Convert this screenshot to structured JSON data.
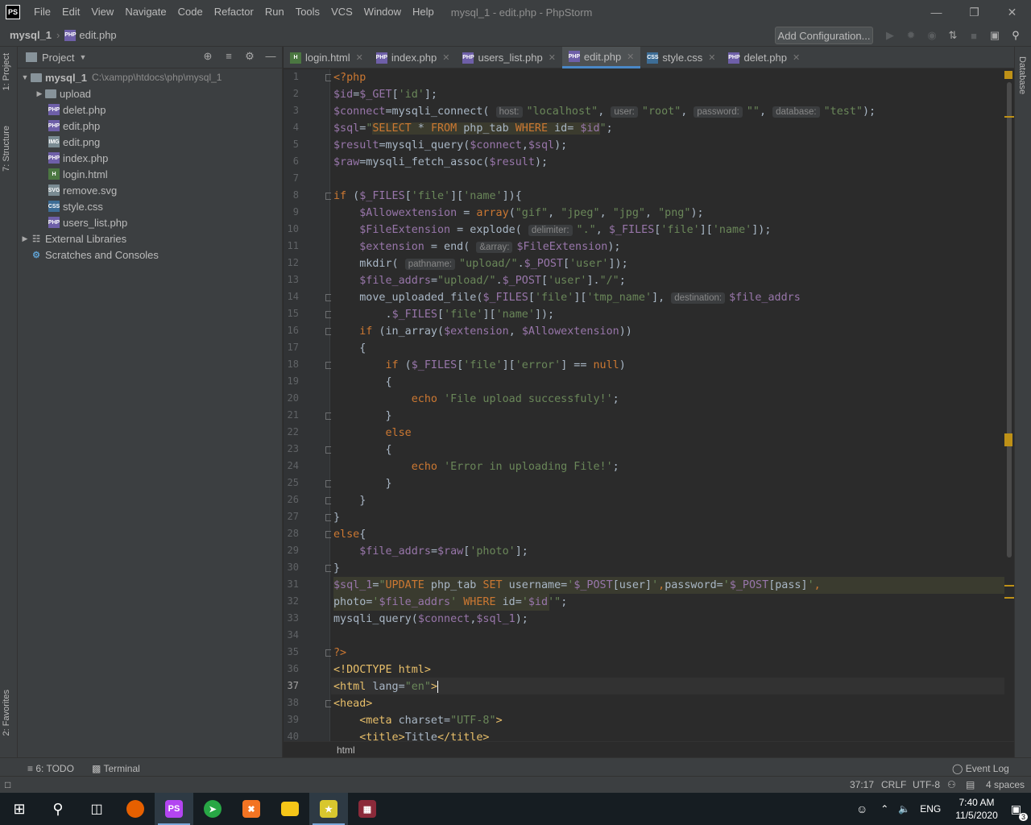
{
  "titlebar": {
    "logo": "PS",
    "menu": [
      "File",
      "Edit",
      "View",
      "Navigate",
      "Code",
      "Refactor",
      "Run",
      "Tools",
      "VCS",
      "Window",
      "Help"
    ],
    "title": "mysql_1 - edit.php - PhpStorm"
  },
  "navbar": {
    "project": "mysql_1",
    "file": "edit.php",
    "add_config": "Add Configuration..."
  },
  "side_tabs": {
    "project": "1: Project",
    "structure": "7: Structure",
    "favorites": "2: Favorites",
    "database": "Database"
  },
  "project_panel": {
    "title": "Project",
    "root": "mysql_1",
    "root_path": "C:\\xampp\\htdocs\\php\\mysql_1",
    "items": [
      {
        "name": "upload",
        "type": "folder"
      },
      {
        "name": "delet.php",
        "type": "php"
      },
      {
        "name": "edit.php",
        "type": "php"
      },
      {
        "name": "edit.png",
        "type": "img"
      },
      {
        "name": "index.php",
        "type": "php"
      },
      {
        "name": "login.html",
        "type": "html"
      },
      {
        "name": "remove.svg",
        "type": "img"
      },
      {
        "name": "style.css",
        "type": "css"
      },
      {
        "name": "users_list.php",
        "type": "php"
      }
    ],
    "external": "External Libraries",
    "scratches": "Scratches and Consoles"
  },
  "tabs": [
    {
      "label": "login.html",
      "type": "html"
    },
    {
      "label": "index.php",
      "type": "php"
    },
    {
      "label": "users_list.php",
      "type": "php"
    },
    {
      "label": "edit.php",
      "type": "php",
      "active": true
    },
    {
      "label": "style.css",
      "type": "css"
    },
    {
      "label": "delet.php",
      "type": "php"
    }
  ],
  "hints": {
    "host": "host:",
    "user": "user:",
    "password": "password:",
    "database": "database:",
    "delimiter": "delimiter:",
    "array": "&array:",
    "pathname": "pathname:",
    "destination": "destination:"
  },
  "code_crumb": "html",
  "toolwindows": {
    "todo": "6: TODO",
    "terminal": "Terminal",
    "event_log": "Event Log"
  },
  "status": {
    "position": "37:17",
    "line_sep": "CRLF",
    "encoding": "UTF-8",
    "indent": "4 spaces"
  },
  "taskbar": {
    "lang": "ENG",
    "time": "7:40 AM",
    "date": "11/5/2020",
    "notif": "3"
  }
}
